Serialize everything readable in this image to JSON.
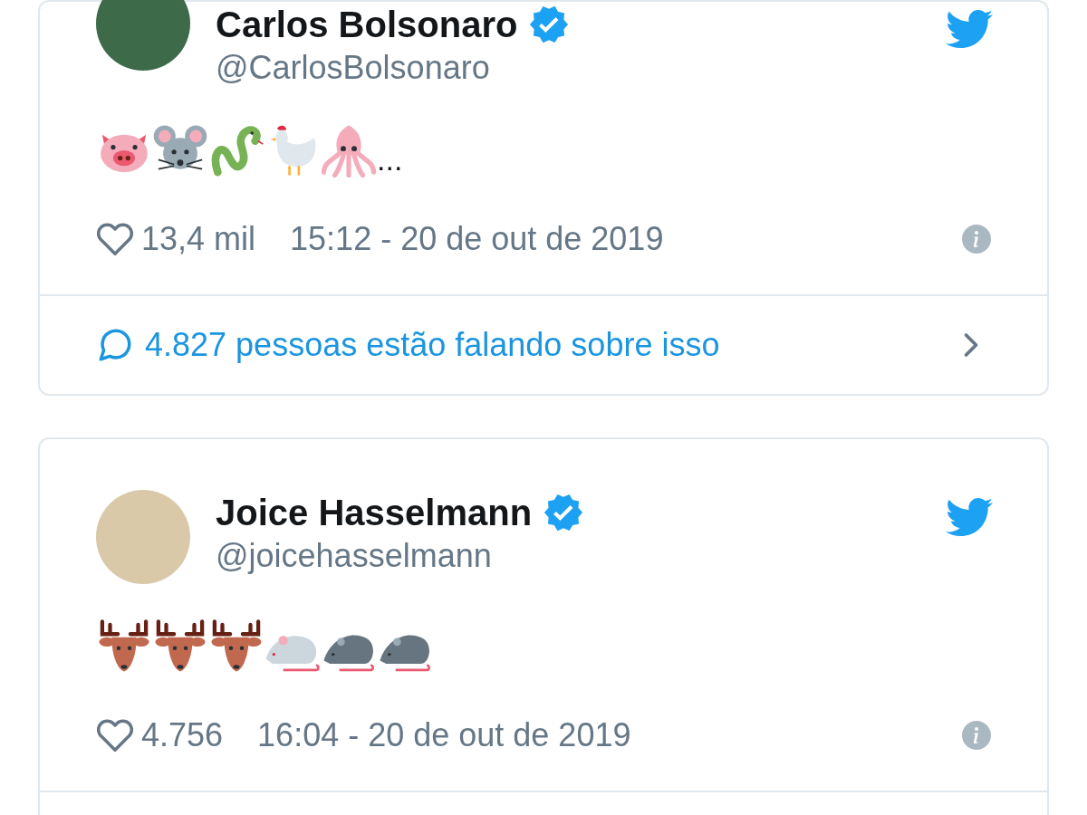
{
  "tweets": [
    {
      "author": {
        "name": "Carlos Bolsonaro",
        "handle": "@CarlosBolsonaro",
        "verified": true
      },
      "emojis": [
        {
          "kind": "pig"
        },
        {
          "kind": "mouse"
        },
        {
          "kind": "snake"
        },
        {
          "kind": "rooster"
        },
        {
          "kind": "squid"
        }
      ],
      "trailing_text": "...",
      "likes": "13,4 mil",
      "timestamp": "15:12 - 20 de out de 2019",
      "conversation": "4.827 pessoas estão falando sobre isso"
    },
    {
      "author": {
        "name": "Joice Hasselmann",
        "handle": "@joicehasselmann",
        "verified": true
      },
      "emojis": [
        {
          "kind": "deer"
        },
        {
          "kind": "deer"
        },
        {
          "kind": "deer"
        },
        {
          "kind": "white-mouse"
        },
        {
          "kind": "rat"
        },
        {
          "kind": "rat"
        }
      ],
      "likes": "4.756",
      "timestamp": "16:04 - 20 de out de 2019"
    }
  ]
}
